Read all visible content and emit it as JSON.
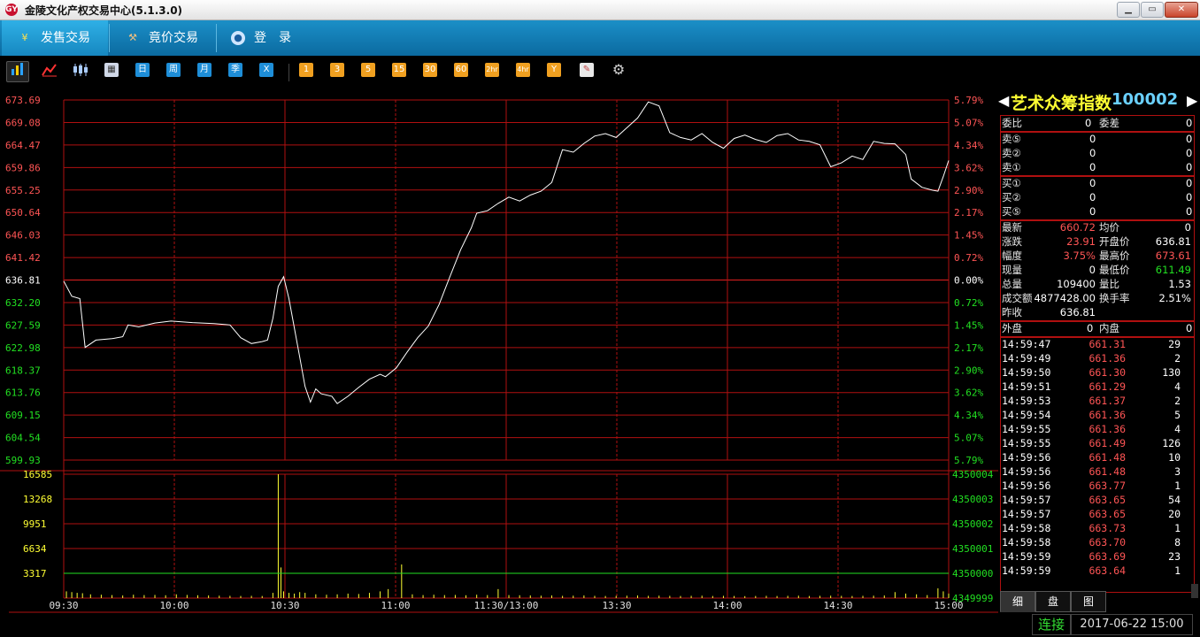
{
  "window": {
    "title": "金陵文化产权交易中心(5.1.3.0)",
    "icon_glyph": "GY"
  },
  "nav": {
    "tabs": [
      {
        "label": "发售交易",
        "icon": "yen-icon",
        "active": true
      },
      {
        "label": "竟价交易",
        "icon": "gavel-icon",
        "active": false
      },
      {
        "label": "登　录",
        "icon": "user-icon",
        "active": false
      }
    ]
  },
  "toolbar": {
    "period_labels": [
      "日",
      "周",
      "月",
      "季",
      "X"
    ],
    "minute_labels": [
      "1",
      "3",
      "5",
      "15",
      "30",
      "60",
      "2hr",
      "4hr",
      "Y"
    ]
  },
  "chart_data": {
    "type": "line",
    "price_axis": {
      "left_ticks": [
        "673.69",
        "669.08",
        "664.47",
        "659.86",
        "655.25",
        "650.64",
        "646.03",
        "641.42",
        "636.81",
        "632.20",
        "627.59",
        "622.98",
        "618.37",
        "613.76",
        "609.15",
        "604.54",
        "599.93"
      ],
      "right_ticks": [
        "5.79%",
        "5.07%",
        "4.34%",
        "3.62%",
        "2.90%",
        "2.17%",
        "1.45%",
        "0.72%",
        "0.00%",
        "0.72%",
        "1.45%",
        "2.17%",
        "2.90%",
        "3.62%",
        "4.34%",
        "5.07%",
        "5.79%"
      ],
      "prev_close": 636.81,
      "ylim": [
        599.93,
        673.69
      ]
    },
    "volume_axis": {
      "left_ticks": [
        "16585",
        "13268",
        "9951",
        "6634",
        "3317"
      ],
      "right_ticks": [
        "4350004",
        "4350003",
        "4350002",
        "4350001",
        "4350000",
        "4349999"
      ],
      "ylim": [
        0,
        16585
      ]
    },
    "time_ticks": [
      "09:30",
      "10:00",
      "10:30",
      "11:00",
      "11:30/13:00",
      "13:30",
      "14:00",
      "14:30",
      "15:00"
    ],
    "price_series": [
      {
        "t": 0,
        "v": 636.6
      },
      {
        "t": 3,
        "v": 633.5
      },
      {
        "t": 6,
        "v": 633.0
      },
      {
        "t": 8,
        "v": 623.0
      },
      {
        "t": 12,
        "v": 624.5
      },
      {
        "t": 18,
        "v": 624.8
      },
      {
        "t": 22,
        "v": 625.2
      },
      {
        "t": 24,
        "v": 627.6
      },
      {
        "t": 28,
        "v": 627.2
      },
      {
        "t": 34,
        "v": 628.0
      },
      {
        "t": 40,
        "v": 628.4
      },
      {
        "t": 48,
        "v": 628.1
      },
      {
        "t": 56,
        "v": 627.9
      },
      {
        "t": 62,
        "v": 627.6
      },
      {
        "t": 66,
        "v": 625.0
      },
      {
        "t": 70,
        "v": 623.8
      },
      {
        "t": 74,
        "v": 624.2
      },
      {
        "t": 76,
        "v": 624.5
      },
      {
        "t": 78,
        "v": 629.0
      },
      {
        "t": 80,
        "v": 635.5
      },
      {
        "t": 82,
        "v": 637.5
      },
      {
        "t": 84,
        "v": 633.0
      },
      {
        "t": 86,
        "v": 627.0
      },
      {
        "t": 88,
        "v": 621.0
      },
      {
        "t": 90,
        "v": 615.0
      },
      {
        "t": 92,
        "v": 611.8
      },
      {
        "t": 94,
        "v": 614.5
      },
      {
        "t": 96,
        "v": 613.5
      },
      {
        "t": 100,
        "v": 613.0
      },
      {
        "t": 102,
        "v": 611.5
      },
      {
        "t": 106,
        "v": 613.0
      },
      {
        "t": 110,
        "v": 614.8
      },
      {
        "t": 114,
        "v": 616.5
      },
      {
        "t": 118,
        "v": 617.5
      },
      {
        "t": 120,
        "v": 617.0
      },
      {
        "t": 124,
        "v": 618.8
      },
      {
        "t": 128,
        "v": 622.0
      },
      {
        "t": 132,
        "v": 625.0
      },
      {
        "t": 136,
        "v": 627.4
      },
      {
        "t": 140,
        "v": 631.8
      },
      {
        "t": 144,
        "v": 637.5
      },
      {
        "t": 148,
        "v": 643.0
      },
      {
        "t": 152,
        "v": 647.5
      },
      {
        "t": 154,
        "v": 650.5
      },
      {
        "t": 158,
        "v": 651.0
      },
      {
        "t": 162,
        "v": 652.5
      },
      {
        "t": 166,
        "v": 653.8
      },
      {
        "t": 170,
        "v": 653.0
      },
      {
        "t": 174,
        "v": 654.2
      },
      {
        "t": 178,
        "v": 655.0
      },
      {
        "t": 182,
        "v": 656.8
      },
      {
        "t": 186,
        "v": 663.5
      },
      {
        "t": 190,
        "v": 663.0
      },
      {
        "t": 194,
        "v": 664.8
      },
      {
        "t": 198,
        "v": 666.3
      },
      {
        "t": 202,
        "v": 666.8
      },
      {
        "t": 206,
        "v": 666.0
      },
      {
        "t": 210,
        "v": 668.0
      },
      {
        "t": 214,
        "v": 670.0
      },
      {
        "t": 218,
        "v": 673.3
      },
      {
        "t": 222,
        "v": 672.5
      },
      {
        "t": 226,
        "v": 667.0
      },
      {
        "t": 230,
        "v": 666.0
      },
      {
        "t": 234,
        "v": 665.5
      },
      {
        "t": 238,
        "v": 666.8
      },
      {
        "t": 242,
        "v": 665.0
      },
      {
        "t": 246,
        "v": 663.8
      },
      {
        "t": 250,
        "v": 665.8
      },
      {
        "t": 254,
        "v": 666.5
      },
      {
        "t": 258,
        "v": 665.6
      },
      {
        "t": 262,
        "v": 665.0
      },
      {
        "t": 266,
        "v": 666.4
      },
      {
        "t": 270,
        "v": 666.8
      },
      {
        "t": 274,
        "v": 665.5
      },
      {
        "t": 278,
        "v": 665.2
      },
      {
        "t": 282,
        "v": 664.5
      },
      {
        "t": 286,
        "v": 660.0
      },
      {
        "t": 290,
        "v": 660.8
      },
      {
        "t": 294,
        "v": 662.2
      },
      {
        "t": 298,
        "v": 661.5
      },
      {
        "t": 302,
        "v": 665.2
      },
      {
        "t": 306,
        "v": 664.8
      },
      {
        "t": 310,
        "v": 664.7
      },
      {
        "t": 314,
        "v": 662.5
      },
      {
        "t": 316,
        "v": 657.5
      },
      {
        "t": 320,
        "v": 655.8
      },
      {
        "t": 324,
        "v": 655.2
      },
      {
        "t": 326,
        "v": 655.0
      },
      {
        "t": 328,
        "v": 658.0
      },
      {
        "t": 330,
        "v": 661.3
      }
    ],
    "volume_series": [
      {
        "t": 1,
        "v": 900
      },
      {
        "t": 3,
        "v": 800
      },
      {
        "t": 5,
        "v": 700
      },
      {
        "t": 7,
        "v": 650
      },
      {
        "t": 10,
        "v": 500
      },
      {
        "t": 14,
        "v": 450
      },
      {
        "t": 18,
        "v": 400
      },
      {
        "t": 22,
        "v": 350
      },
      {
        "t": 26,
        "v": 450
      },
      {
        "t": 30,
        "v": 400
      },
      {
        "t": 34,
        "v": 420
      },
      {
        "t": 38,
        "v": 380
      },
      {
        "t": 42,
        "v": 500
      },
      {
        "t": 46,
        "v": 420
      },
      {
        "t": 50,
        "v": 380
      },
      {
        "t": 54,
        "v": 350
      },
      {
        "t": 58,
        "v": 320
      },
      {
        "t": 62,
        "v": 300
      },
      {
        "t": 66,
        "v": 280
      },
      {
        "t": 70,
        "v": 300
      },
      {
        "t": 74,
        "v": 280
      },
      {
        "t": 78,
        "v": 700
      },
      {
        "t": 80,
        "v": 16585
      },
      {
        "t": 81,
        "v": 4100
      },
      {
        "t": 82,
        "v": 900
      },
      {
        "t": 84,
        "v": 700
      },
      {
        "t": 86,
        "v": 600
      },
      {
        "t": 88,
        "v": 800
      },
      {
        "t": 90,
        "v": 700
      },
      {
        "t": 94,
        "v": 500
      },
      {
        "t": 98,
        "v": 450
      },
      {
        "t": 102,
        "v": 500
      },
      {
        "t": 106,
        "v": 600
      },
      {
        "t": 110,
        "v": 550
      },
      {
        "t": 114,
        "v": 700
      },
      {
        "t": 118,
        "v": 900
      },
      {
        "t": 121,
        "v": 1200
      },
      {
        "t": 126,
        "v": 4500
      },
      {
        "t": 130,
        "v": 500
      },
      {
        "t": 134,
        "v": 400
      },
      {
        "t": 138,
        "v": 450
      },
      {
        "t": 142,
        "v": 400
      },
      {
        "t": 146,
        "v": 420
      },
      {
        "t": 150,
        "v": 380
      },
      {
        "t": 154,
        "v": 450
      },
      {
        "t": 158,
        "v": 400
      },
      {
        "t": 162,
        "v": 1200
      },
      {
        "t": 166,
        "v": 400
      },
      {
        "t": 170,
        "v": 380
      },
      {
        "t": 174,
        "v": 350
      },
      {
        "t": 178,
        "v": 320
      },
      {
        "t": 182,
        "v": 350
      },
      {
        "t": 186,
        "v": 300
      },
      {
        "t": 190,
        "v": 320
      },
      {
        "t": 194,
        "v": 350
      },
      {
        "t": 198,
        "v": 300
      },
      {
        "t": 202,
        "v": 280
      },
      {
        "t": 206,
        "v": 300
      },
      {
        "t": 210,
        "v": 320
      },
      {
        "t": 214,
        "v": 350
      },
      {
        "t": 218,
        "v": 300
      },
      {
        "t": 222,
        "v": 320
      },
      {
        "t": 226,
        "v": 300
      },
      {
        "t": 230,
        "v": 280
      },
      {
        "t": 234,
        "v": 300
      },
      {
        "t": 238,
        "v": 320
      },
      {
        "t": 242,
        "v": 280
      },
      {
        "t": 246,
        "v": 300
      },
      {
        "t": 250,
        "v": 280
      },
      {
        "t": 254,
        "v": 260
      },
      {
        "t": 258,
        "v": 280
      },
      {
        "t": 262,
        "v": 300
      },
      {
        "t": 266,
        "v": 280
      },
      {
        "t": 270,
        "v": 300
      },
      {
        "t": 274,
        "v": 320
      },
      {
        "t": 278,
        "v": 280
      },
      {
        "t": 282,
        "v": 300
      },
      {
        "t": 286,
        "v": 320
      },
      {
        "t": 290,
        "v": 300
      },
      {
        "t": 294,
        "v": 280
      },
      {
        "t": 298,
        "v": 300
      },
      {
        "t": 302,
        "v": 320
      },
      {
        "t": 306,
        "v": 350
      },
      {
        "t": 310,
        "v": 800
      },
      {
        "t": 314,
        "v": 600
      },
      {
        "t": 318,
        "v": 500
      },
      {
        "t": 322,
        "v": 400
      },
      {
        "t": 326,
        "v": 1300
      },
      {
        "t": 328,
        "v": 900
      },
      {
        "t": 330,
        "v": 600
      }
    ],
    "total_minutes": 330,
    "avg_line_value": 3317
  },
  "quote": {
    "name": "艺术众筹指数",
    "code": "100002",
    "weibi_label": "委比",
    "weibi_value": "0",
    "weicha_label": "委差",
    "weicha_value": "0",
    "sells": [
      {
        "label": "卖⑤",
        "price": "0",
        "vol": "0"
      },
      {
        "label": "卖②",
        "price": "0",
        "vol": "0"
      },
      {
        "label": "卖①",
        "price": "0",
        "vol": "0"
      }
    ],
    "buys": [
      {
        "label": "买①",
        "price": "0",
        "vol": "0"
      },
      {
        "label": "买②",
        "price": "0",
        "vol": "0"
      },
      {
        "label": "买⑤",
        "price": "0",
        "vol": "0"
      }
    ],
    "stats": [
      {
        "l1": "最新",
        "v1": "660.72",
        "c1": "red",
        "l2": "均价",
        "v2": "0",
        "c2": "wht"
      },
      {
        "l1": "涨跌",
        "v1": "23.91",
        "c1": "red",
        "l2": "开盘价",
        "v2": "636.81",
        "c2": "wht"
      },
      {
        "l1": "幅度",
        "v1": "3.75%",
        "c1": "red",
        "l2": "最高价",
        "v2": "673.61",
        "c2": "red"
      },
      {
        "l1": "现量",
        "v1": "0",
        "c1": "wht",
        "l2": "最低价",
        "v2": "611.49",
        "c2": "grn"
      },
      {
        "l1": "总量",
        "v1": "109400",
        "c1": "wht",
        "l2": "量比",
        "v2": "1.53",
        "c2": "wht"
      },
      {
        "l1": "成交额",
        "v1": "4877428.00",
        "c1": "wht",
        "l2": "换手率",
        "v2": "2.51%",
        "c2": "wht"
      },
      {
        "l1": "昨收",
        "v1": "636.81",
        "c1": "wht",
        "l2": "",
        "v2": "",
        "c2": "wht"
      }
    ],
    "waipan_label": "外盘",
    "waipan_value": "0",
    "neipan_label": "内盘",
    "neipan_value": "0",
    "ticks": [
      {
        "time": "14:59:47",
        "price": "661.31",
        "vol": "29"
      },
      {
        "time": "14:59:49",
        "price": "661.36",
        "vol": "2"
      },
      {
        "time": "14:59:50",
        "price": "661.30",
        "vol": "130"
      },
      {
        "time": "14:59:51",
        "price": "661.29",
        "vol": "4"
      },
      {
        "time": "14:59:53",
        "price": "661.37",
        "vol": "2"
      },
      {
        "time": "14:59:54",
        "price": "661.36",
        "vol": "5"
      },
      {
        "time": "14:59:55",
        "price": "661.36",
        "vol": "4"
      },
      {
        "time": "14:59:55",
        "price": "661.49",
        "vol": "126"
      },
      {
        "time": "14:59:56",
        "price": "661.48",
        "vol": "10"
      },
      {
        "time": "14:59:56",
        "price": "661.48",
        "vol": "3"
      },
      {
        "time": "14:59:56",
        "price": "663.77",
        "vol": "1"
      },
      {
        "time": "14:59:57",
        "price": "663.65",
        "vol": "54"
      },
      {
        "time": "14:59:57",
        "price": "663.65",
        "vol": "20"
      },
      {
        "time": "14:59:58",
        "price": "663.73",
        "vol": "1"
      },
      {
        "time": "14:59:58",
        "price": "663.70",
        "vol": "8"
      },
      {
        "time": "14:59:59",
        "price": "663.69",
        "vol": "23"
      },
      {
        "time": "14:59:59",
        "price": "663.64",
        "vol": "1"
      }
    ]
  },
  "bottom_tabs": [
    "细",
    "盘",
    "图"
  ],
  "status": {
    "connection": "连接",
    "datetime": "2017-06-22 15:00"
  },
  "colors": {
    "grid": "#b01010",
    "price_line": "#ffffff",
    "volume": "#ffff33",
    "avg_line": "#22e022",
    "up": "#ff5555",
    "down": "#22e022"
  }
}
